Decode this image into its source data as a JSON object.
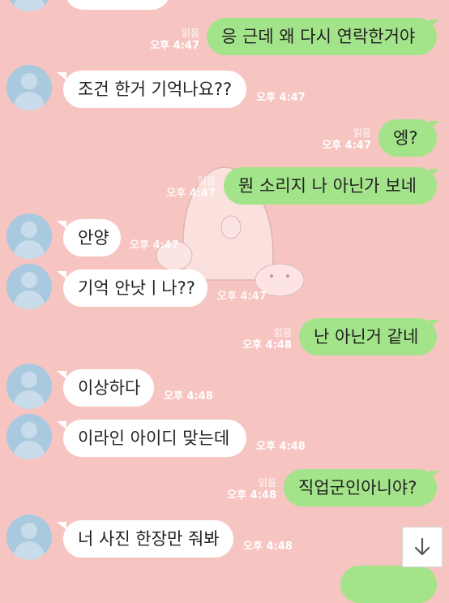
{
  "messages": [
    {
      "id": "m0",
      "side": "right",
      "text": "응 근데 왜 다시 연락한거야",
      "read": "읽음",
      "time": "오후 4:47"
    },
    {
      "id": "m1",
      "side": "left",
      "text": "조건 한거 기억나요??",
      "time": "오후 4:47"
    },
    {
      "id": "m2",
      "side": "right",
      "text": "엥?",
      "read": "읽음",
      "time": "오후 4:47"
    },
    {
      "id": "m3",
      "side": "right",
      "text": "뭔 소리지 나 아닌가 보네",
      "read": "읽음",
      "time": "오후 4:47"
    },
    {
      "id": "m4",
      "side": "left",
      "text": "안양",
      "time": "오후 4:47"
    },
    {
      "id": "m5",
      "side": "left",
      "text": "기억 안낫ㅣ나??",
      "time": "오후 4:47"
    },
    {
      "id": "m6",
      "side": "right",
      "text": "난 아닌거 같네",
      "read": "읽음",
      "time": "오후 4:48"
    },
    {
      "id": "m7",
      "side": "left",
      "text": "이상하다",
      "time": "오후 4:48"
    },
    {
      "id": "m8",
      "side": "left",
      "text": "이라인 아이디 맞는데",
      "time": "오후 4:48"
    },
    {
      "id": "m9",
      "side": "right",
      "text": "직업군인아니야?",
      "read": "읽음",
      "time": "오후 4:48"
    },
    {
      "id": "m10",
      "side": "left",
      "text": "너 사진 한장만 줘봐",
      "time": "오후 4:48"
    }
  ],
  "icons": {
    "avatar": "profile-silhouette-icon",
    "scroll": "arrow-down-icon"
  },
  "colors": {
    "background": "#f7c5c1",
    "right_bubble": "#a3e38a",
    "left_bubble": "#ffffff",
    "avatar": "#a9c9df"
  }
}
